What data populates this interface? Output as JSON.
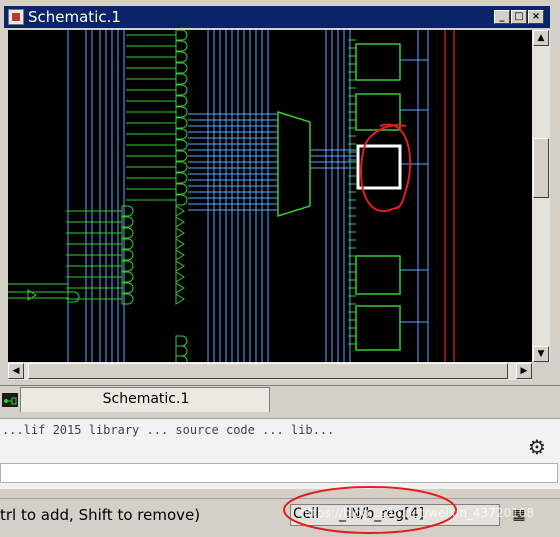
{
  "window": {
    "title": "Schematic.1",
    "minimize_glyph": "_",
    "maximize_glyph": "□",
    "close_glyph": "×"
  },
  "tab": {
    "label": "Schematic.1",
    "icon": "schematic-icon"
  },
  "console": {
    "text": "...lif 2015 library ... source code ... lib...",
    "gear_icon": "gear-icon"
  },
  "status": {
    "hint": "trl to add, Shift to remove)",
    "cell_label": "Cell",
    "cell_value": "_IN/b_reg[4]",
    "button_glyph": "▦"
  },
  "watermark": "https://blog.csdn.net/weixin_43720108",
  "colors": {
    "canvas": "#000000",
    "wire": "#5aa9ff",
    "gate": "#33cc33",
    "selection": "#ffffff",
    "annotation": "#e0201e",
    "titlebar": "#0a246a"
  }
}
